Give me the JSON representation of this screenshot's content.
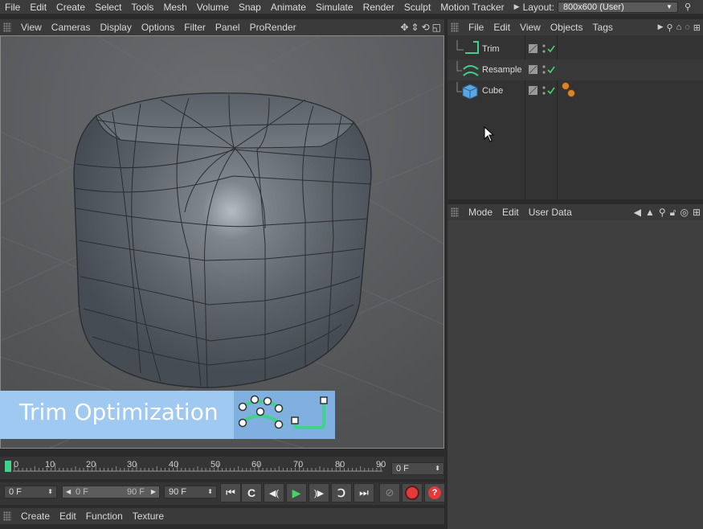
{
  "main_menu": {
    "items": [
      "File",
      "Edit",
      "Create",
      "Select",
      "Tools",
      "Mesh",
      "Volume",
      "Snap",
      "Animate",
      "Simulate",
      "Render",
      "Sculpt",
      "Motion Tracker"
    ],
    "layout_label": "Layout:",
    "layout_value": "800x600 (User)"
  },
  "viewport_menu": {
    "items": [
      "View",
      "Cameras",
      "Display",
      "Options",
      "Filter",
      "Panel",
      "ProRender"
    ]
  },
  "banner": {
    "title": "Trim Optimization"
  },
  "timeline": {
    "ticks": [
      "0",
      "10",
      "20",
      "30",
      "40",
      "50",
      "60",
      "70",
      "80",
      "90"
    ],
    "current_frame": "0 F"
  },
  "controls": {
    "start_frame": "0 F",
    "range_start": "0 F",
    "range_end": "90 F",
    "end_frame": "90 F"
  },
  "bottom_menu": {
    "items": [
      "Create",
      "Edit",
      "Function",
      "Texture"
    ]
  },
  "object_manager": {
    "menu": [
      "File",
      "Edit",
      "View",
      "Objects",
      "Tags"
    ],
    "objects": [
      {
        "name": "Trim",
        "icon": "trim-icon"
      },
      {
        "name": "Resample",
        "icon": "resample-icon"
      },
      {
        "name": "Cube",
        "icon": "cube-icon"
      }
    ]
  },
  "attribute_manager": {
    "menu": [
      "Mode",
      "Edit",
      "User Data"
    ]
  },
  "colors": {
    "banner_bg": "#9fc9f0",
    "accent_green": "#3fd28a",
    "play_green": "#46d46a",
    "record_red": "#e43a3a"
  }
}
